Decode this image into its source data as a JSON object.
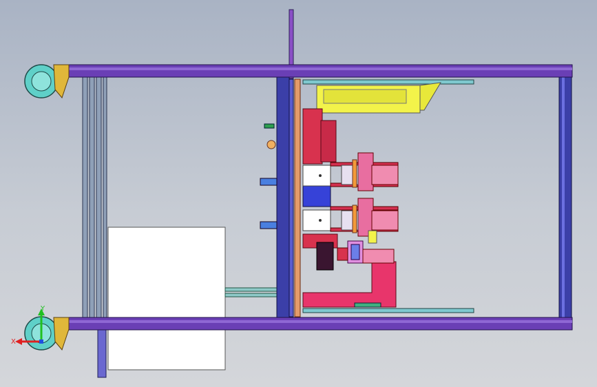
{
  "scene": {
    "background_top": "#a9b3c4",
    "background_bottom": "#d4d6da",
    "frame_color": "#6a3fb5",
    "frame_light": "#8f67d4",
    "post_color": "#3b3fa8",
    "caster_color": "#5fd0c8",
    "bracket_color": "#e0b73a"
  },
  "triad": {
    "x_label": "X",
    "y_label": "Y",
    "x_color": "#e02020",
    "y_color": "#20c020",
    "z_color": "#2050e0"
  }
}
